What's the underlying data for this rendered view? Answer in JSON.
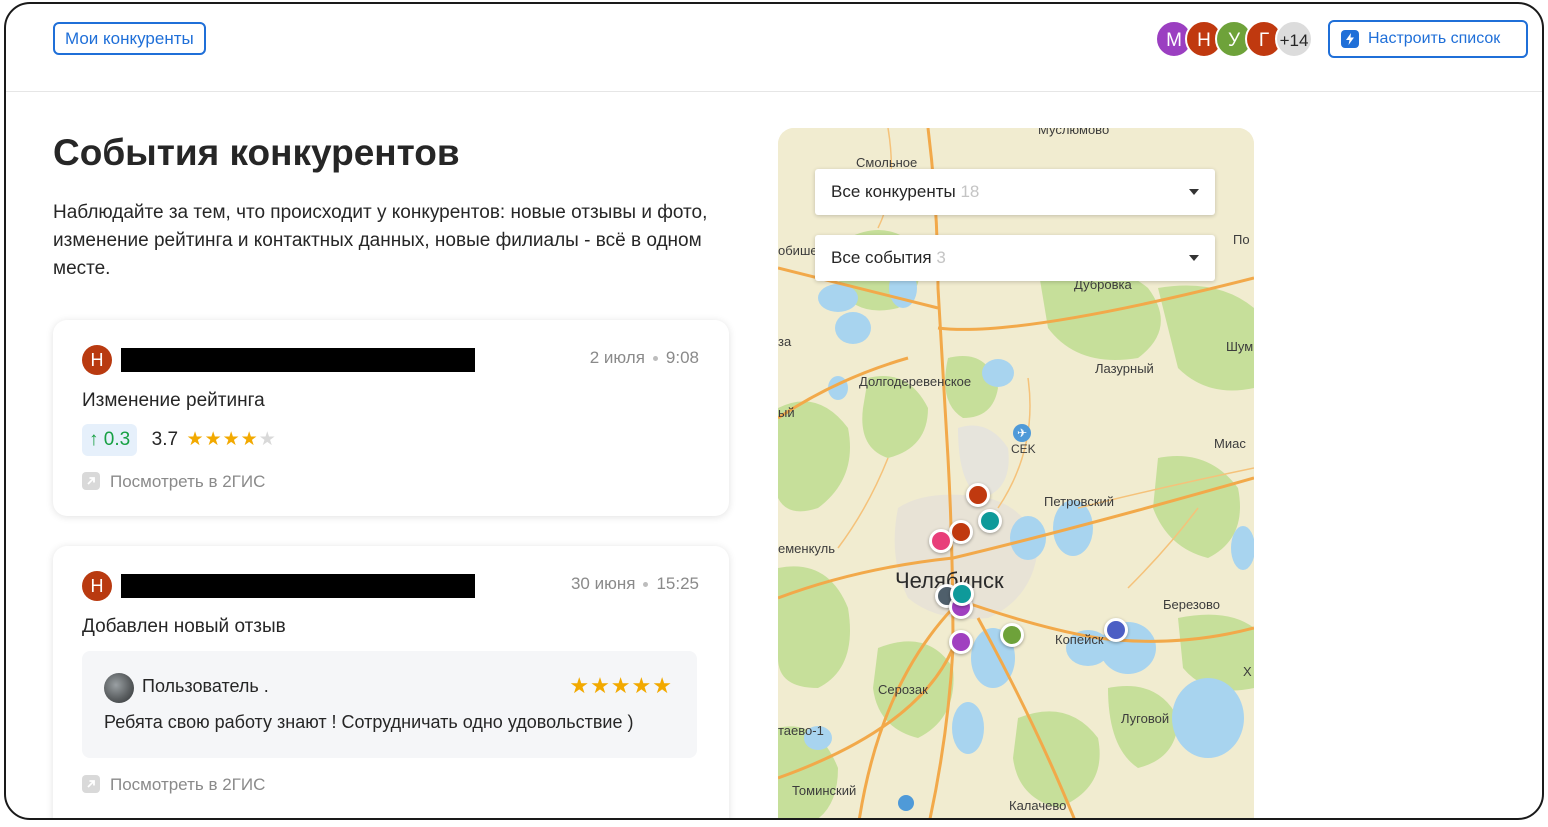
{
  "header": {
    "my_competitors_label": "Мои конкуренты",
    "avatars": [
      {
        "letter": "М",
        "color": "#9b3fc1"
      },
      {
        "letter": "Н",
        "color": "#c0390f"
      },
      {
        "letter": "У",
        "color": "#6ea23a"
      },
      {
        "letter": "Г",
        "color": "#c0390f"
      }
    ],
    "avatars_more": "+14",
    "setup_label": "Настроить список"
  },
  "main": {
    "title": "События конкурентов",
    "description": "Наблюдайте за тем, что происходит у конкурентов: новые отзывы и фото, изменение рейтинга и контактных данных, новые филиалы - всё в одном месте."
  },
  "events": [
    {
      "avatar_letter": "Н",
      "date": "2 июля",
      "time": "9:08",
      "title": "Изменение рейтинга",
      "rating_delta": "0.3",
      "rating": "3.7",
      "stars_filled": 4,
      "stars_total": 5,
      "link_label": "Посмотреть в 2ГИС"
    },
    {
      "avatar_letter": "Н",
      "date": "30 июня",
      "time": "15:25",
      "title": "Добавлен новый отзыв",
      "review": {
        "author": "Пользователь .",
        "stars": 5,
        "text": "Ребята свою работу знают ! Сотрудничать одно удовольствие )"
      },
      "link_label": "Посмотреть в 2ГИС"
    }
  ],
  "map": {
    "filter_competitors": {
      "label": "Все конкуренты",
      "count": "18"
    },
    "filter_events": {
      "label": "Все события",
      "count": "3"
    },
    "labels": {
      "muslyumovo": "Муслюмово",
      "smolnoe": "Смольное",
      "dubrovka": "Дубровка",
      "dolgoderevenskoe": "Долгодеревенское",
      "lazurny": "Лазурный",
      "sek": "CEK",
      "petrovsky": "Петровский",
      "chelyabinsk": "Челябинск",
      "berezovo": "Березово",
      "kopeysk": "Копейск",
      "serozak": "Серозак",
      "lugovoy": "Луговой",
      "tominsky": "Томинский",
      "kalachevo": "Калачево",
      "shum": "Шум",
      "mias": "Миас",
      "emenkul": "еменкуль",
      "po": "По",
      "obishe": "обише",
      "za": "за",
      "iy": "ый",
      "taevo": "таево-1",
      "kh": "Х"
    },
    "pin_colors": {
      "red": "#c0390f",
      "teal": "#0e9a9a",
      "pink": "#e83e7a",
      "slate": "#4f5f6b",
      "purple": "#a040c0",
      "green": "#6ea23a",
      "blue": "#4c5fc4"
    }
  }
}
